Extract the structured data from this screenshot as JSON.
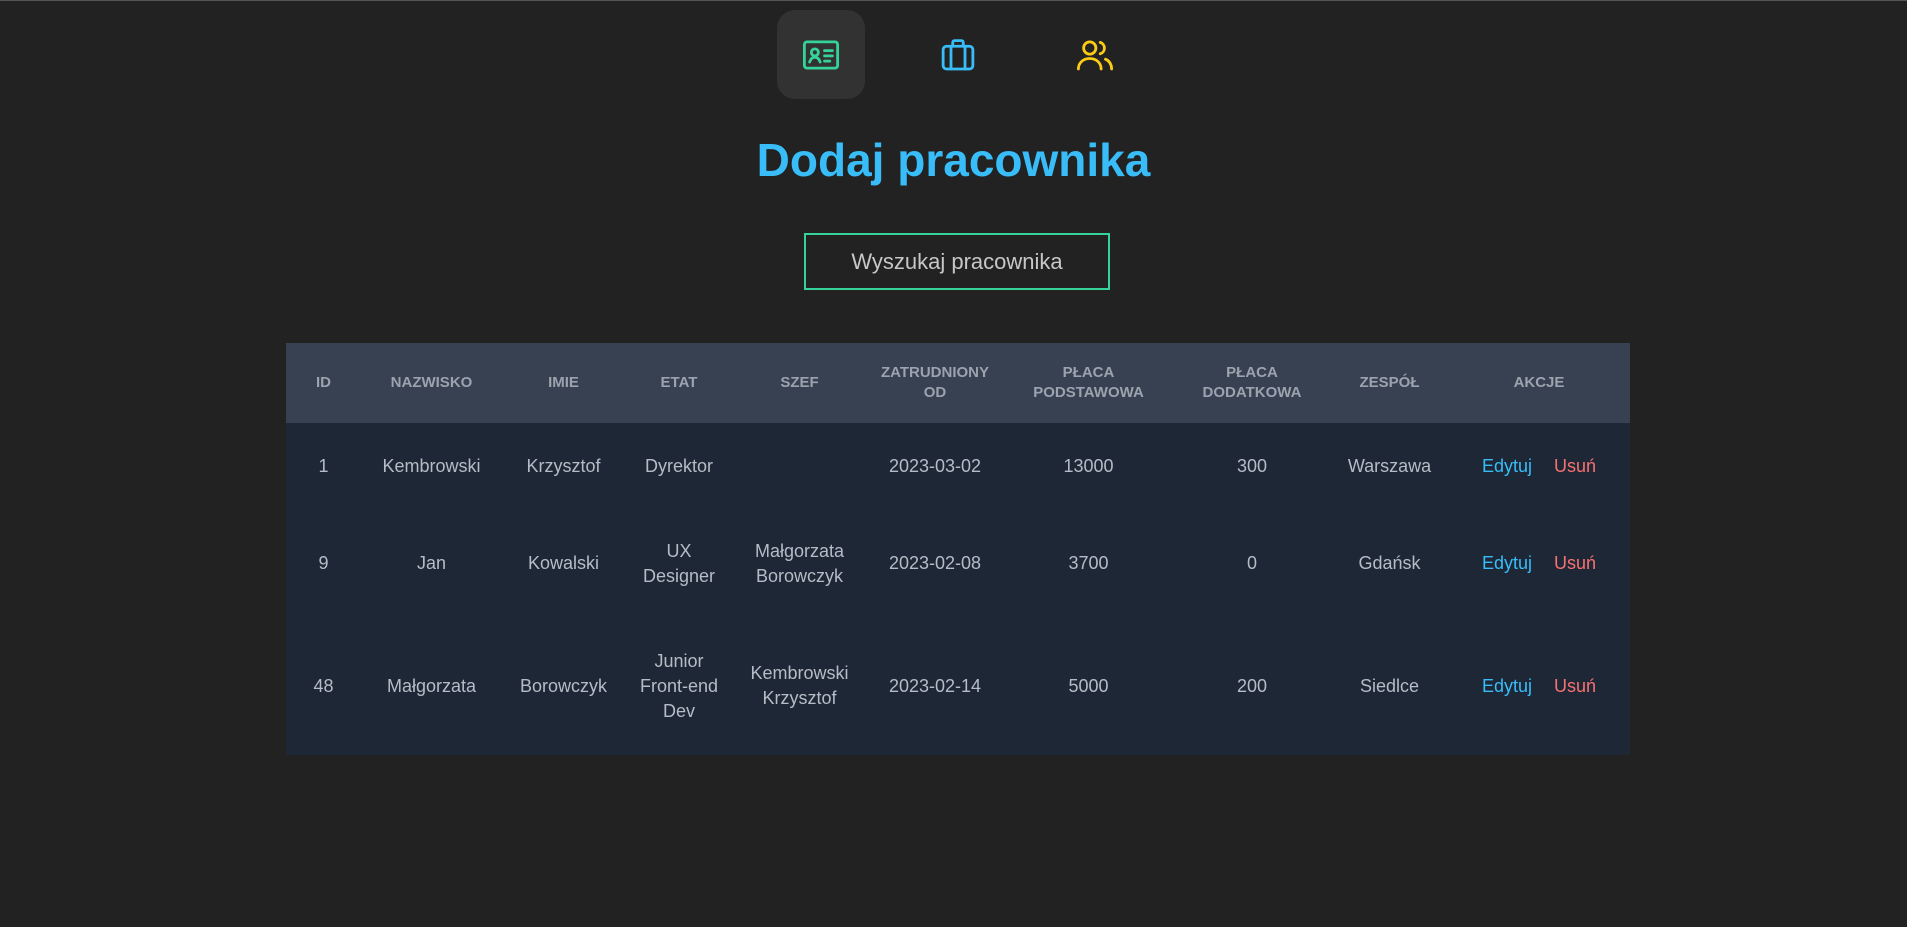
{
  "colors": {
    "background": "#222222",
    "accent_blue": "#38bdf8",
    "accent_green": "#34d399",
    "accent_yellow": "#facc15",
    "delete_red": "#f87171",
    "table_header_bg": "#374151",
    "table_row_bg": "#1e2736"
  },
  "nav": {
    "items": [
      {
        "icon": "id-card-icon",
        "active": true
      },
      {
        "icon": "briefcase-icon",
        "active": false
      },
      {
        "icon": "users-icon",
        "active": false
      }
    ]
  },
  "page": {
    "title": "Dodaj pracownika",
    "search_button": "Wyszukaj pracownika"
  },
  "table": {
    "headers": [
      "ID",
      "NAZWISKO",
      "IMIE",
      "ETAT",
      "SZEF",
      "ZATRUDNIONY OD",
      "PŁACA PODSTAWOWA",
      "PŁACA DODATKOWA",
      "ZESPÓŁ",
      "AKCJE"
    ],
    "rows": [
      {
        "id": "1",
        "nazwisko": "Kembrowski",
        "imie": "Krzysztof",
        "etat": "Dyrektor",
        "szef": "",
        "zatrudniony": "2023-03-02",
        "placa_pod": "13000",
        "placa_dod": "300",
        "zespol": "Warszawa",
        "edit": "Edytuj",
        "delete": "Usuń"
      },
      {
        "id": "9",
        "nazwisko": "Jan",
        "imie": "Kowalski",
        "etat": "UX Designer",
        "szef": "Małgorzata Borowczyk",
        "zatrudniony": "2023-02-08",
        "placa_pod": "3700",
        "placa_dod": "0",
        "zespol": "Gdańsk",
        "edit": "Edytuj",
        "delete": "Usuń"
      },
      {
        "id": "48",
        "nazwisko": "Małgorzata",
        "imie": "Borowczyk",
        "etat": "Junior Front-end Dev",
        "szef": "Kembrowski Krzysztof",
        "zatrudniony": "2023-02-14",
        "placa_pod": "5000",
        "placa_dod": "200",
        "zespol": "Siedlce",
        "edit": "Edytuj",
        "delete": "Usuń"
      }
    ]
  }
}
